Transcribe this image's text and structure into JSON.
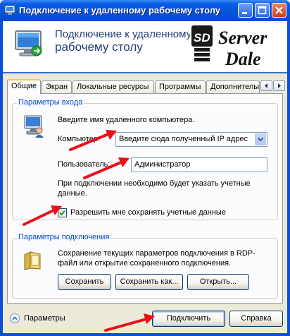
{
  "window": {
    "title": "Подключение к удаленному рабочему столу"
  },
  "header": {
    "title_line1": "Подключение к удаленному",
    "title_line2": "рабочему столу"
  },
  "tabs": [
    {
      "label": "Общие"
    },
    {
      "label": "Экран"
    },
    {
      "label": "Локальные ресурсы"
    },
    {
      "label": "Программы"
    },
    {
      "label": "Дополнителы"
    }
  ],
  "login_group": {
    "title": "Параметры входа",
    "prompt": "Введите имя удаленного компьютера.",
    "computer_label": "Компьютер:",
    "computer_value": "Введите сюда полученный IP адрес",
    "user_label": "Пользователь:",
    "user_value": "Администратор",
    "note": "При подключении необходимо будет указать учетные данные.",
    "save_credentials_label": "Разрешить мне сохранять учетные данные",
    "save_credentials_checked": true
  },
  "connection_group": {
    "title": "Параметры подключения",
    "description": "Сохранение текущих параметров подключения в RDP-файл или открытие сохраненного подключения.",
    "save_label": "Сохранить",
    "save_as_label": "Сохранить как...",
    "open_label": "Открыть..."
  },
  "footer": {
    "options_label": "Параметры",
    "connect_label": "Подключить",
    "help_label": "Справка"
  },
  "colors": {
    "title_bar": "#0553d8",
    "accent_label": "#0046d5",
    "annotation_arrow": "#e8101a"
  }
}
